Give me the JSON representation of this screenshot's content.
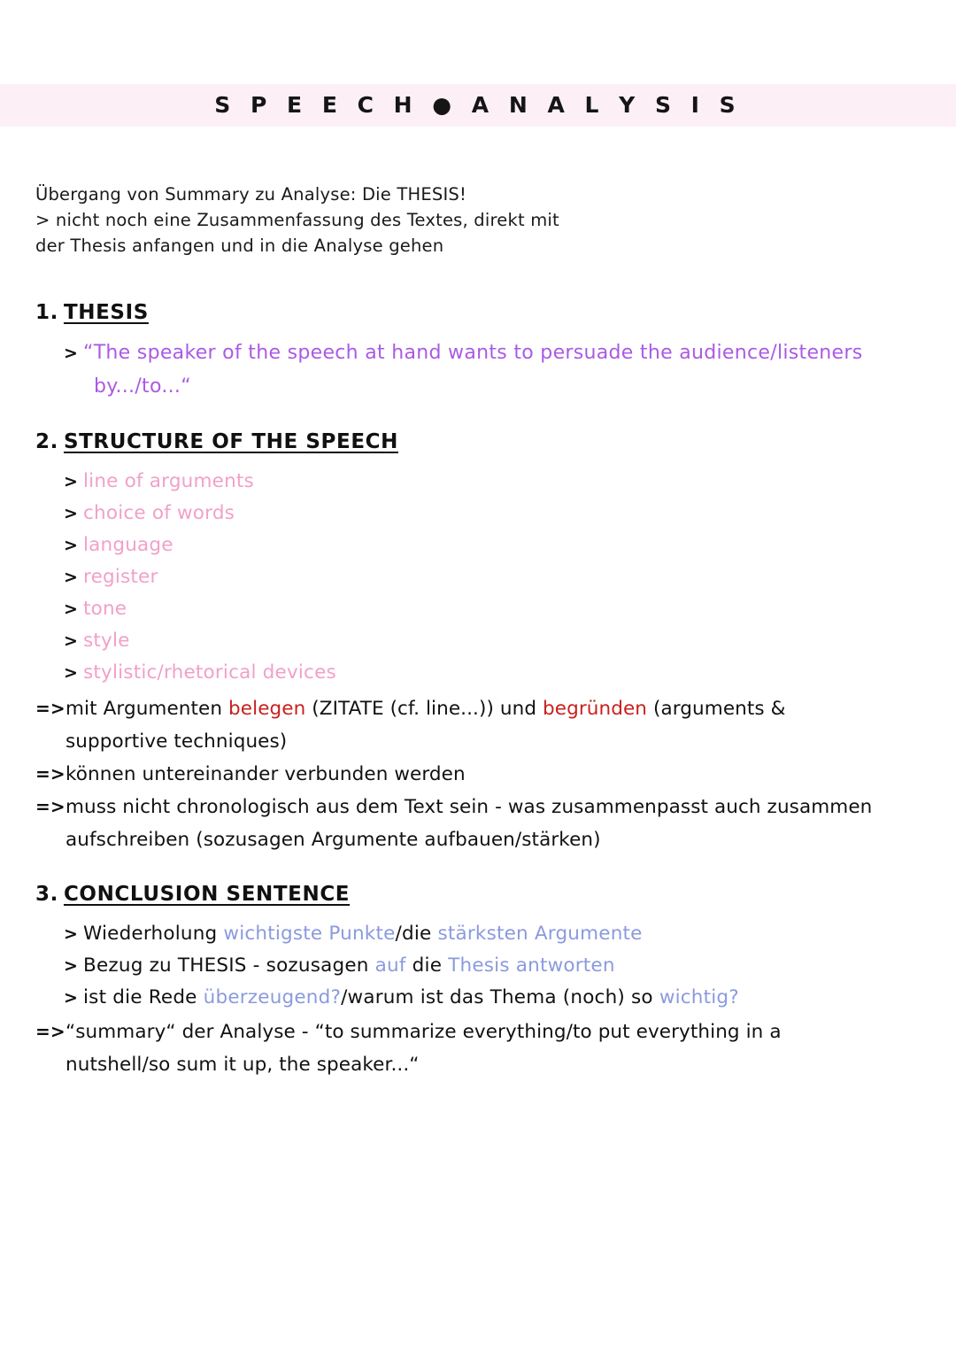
{
  "page": {
    "title": "S P E E C H ● A N A L Y S I S",
    "band_color": "#fdeff6",
    "background": "#ffffff"
  },
  "colors": {
    "purple": "#ab5ae4",
    "pink": "#f2a0c9",
    "red": "#c8201d",
    "blue": "#8b9ade",
    "black": "#111111"
  },
  "intro": {
    "line1": "Übergang von Summary zu Analyse: Die THESIS!",
    "line2": "> nicht noch eine Zusammenfassung des Textes, direkt mit",
    "line3": "der Thesis anfangen und in die Analyse gehen"
  },
  "sections": {
    "thesis": {
      "number": "1.",
      "title": "THESIS",
      "bullet_marker": ">",
      "quote_line1": "“The speaker of the speech at hand wants to persuade the audience/listeners",
      "quote_line2": "by.../to...“"
    },
    "structure": {
      "number": "2.",
      "title": "STRUCTURE OF THE SPEECH",
      "bullet_marker": ">",
      "items": [
        "line of arguments",
        "choice of words",
        "language",
        "register",
        "tone",
        "style",
        "stylistic/rhetorical devices"
      ],
      "arrow_marker": "=>",
      "arrows": [
        {
          "parts": [
            {
              "text": "mit Argumenten ",
              "color": "black"
            },
            {
              "text": "belegen",
              "color": "red"
            },
            {
              "text": " (ZITATE (cf. line...)) und ",
              "color": "black"
            },
            {
              "text": "begründen",
              "color": "red"
            },
            {
              "text": " (arguments &",
              "color": "black"
            }
          ],
          "continuation": "supportive techniques)"
        },
        {
          "parts": [
            {
              "text": "können untereinander verbunden werden",
              "color": "black"
            }
          ],
          "continuation": ""
        },
        {
          "parts": [
            {
              "text": "muss nicht chronologisch aus dem Text sein - was zusammenpasst auch zusammen",
              "color": "black"
            }
          ],
          "continuation": "aufschreiben (sozusagen Argumente aufbauen/stärken)"
        }
      ]
    },
    "conclusion": {
      "number": "3.",
      "title": "CONCLUSION SENTENCE",
      "bullet_marker": ">",
      "items": [
        {
          "parts": [
            {
              "text": "Wiederholung ",
              "color": "black"
            },
            {
              "text": "wichtigste Punkte",
              "color": "blue"
            },
            {
              "text": "/die ",
              "color": "black"
            },
            {
              "text": "stärksten Argumente",
              "color": "blue"
            }
          ]
        },
        {
          "parts": [
            {
              "text": "Bezug zu THESIS - sozusagen ",
              "color": "black"
            },
            {
              "text": "auf",
              "color": "blue"
            },
            {
              "text": " die ",
              "color": "black"
            },
            {
              "text": "Thesis antworten",
              "color": "blue"
            }
          ]
        },
        {
          "parts": [
            {
              "text": "ist die Rede ",
              "color": "black"
            },
            {
              "text": "überzeugend?",
              "color": "blue"
            },
            {
              "text": "/warum ist das Thema (noch) so ",
              "color": "black"
            },
            {
              "text": "wichtig?",
              "color": "blue"
            }
          ]
        }
      ],
      "arrow_marker": "=>",
      "arrow_line1": "“summary“ der Analyse - “to summarize everything/to put everything in a",
      "arrow_line2": "nutshell/so sum it up, the speaker...“"
    }
  }
}
